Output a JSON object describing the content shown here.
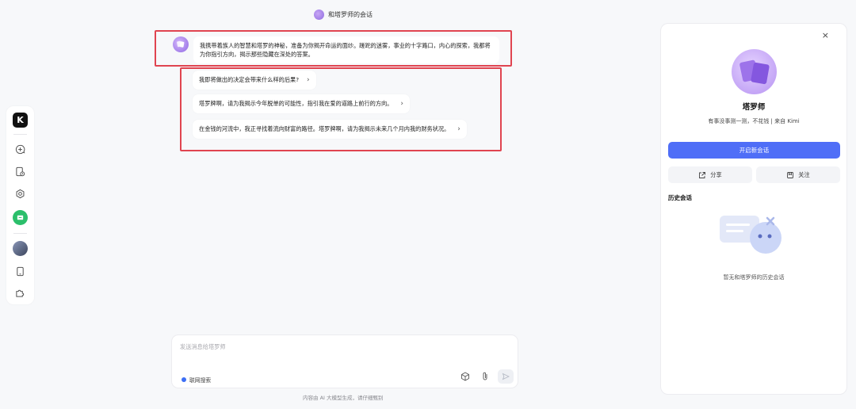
{
  "rail": {
    "logo_glyph": "K",
    "items": [
      "new-chat-icon",
      "history-icon",
      "explore-icon",
      "kimi-plus-icon",
      "avatar",
      "mobile-icon",
      "plugin-icon"
    ]
  },
  "chat": {
    "title": "和塔罗师的会话",
    "bot_message": "我携带着族人的智慧和塔罗的神秘，准备为你揭开命运的面纱。蹉跎的迷雾，事业的十字路口，内心的探索，我都将为你指引方向，揭示那些隐藏在深处的答案。",
    "suggestions": [
      "我即将做出的决定会带来什么样的后果?",
      "塔罗牌啊，请为我揭示今年脱单的可能性，指引我在爱的道路上前行的方向。",
      "在金钱的河流中，我正寻找着流向财富的路径。塔罗牌啊，请为我揭示未来几个月内我的财务状况。"
    ]
  },
  "input": {
    "placeholder": "发送消息给塔罗师",
    "net_search_label": "联网搜索"
  },
  "footer_note": "内容由 AI 大模型生成，请仔细甄别",
  "panel": {
    "close_glyph": "×",
    "name": "塔罗师",
    "description": "有事没事测一测，不花钱 | 来自 Kimi",
    "new_chat_label": "开启新会话",
    "share_label": "分享",
    "follow_label": "关注",
    "history_title": "历史会话",
    "empty_text": "暂无和塔罗师的历史会话"
  },
  "colors": {
    "accent": "#4f6ef7",
    "highlight": "#e04450"
  }
}
